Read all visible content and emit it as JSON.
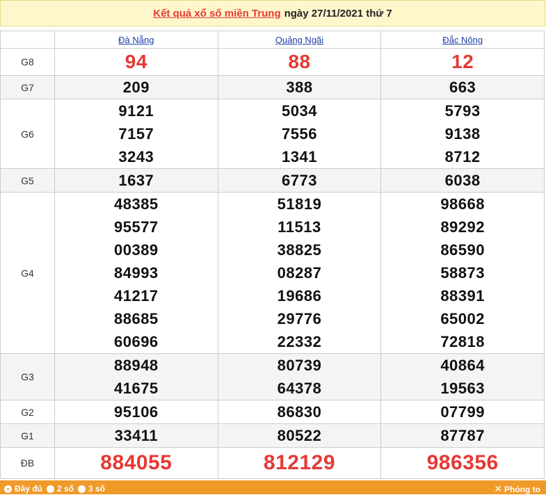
{
  "header": {
    "title_link": "Kết quả xổ số miền Trung",
    "date_text": "ngày 27/11/2021 thứ 7"
  },
  "provinces": [
    "Đà Nẵng",
    "Quảng Ngãi",
    "Đắc Nông"
  ],
  "prizes": [
    {
      "label": "G8",
      "style": "red",
      "values": [
        [
          "94"
        ],
        [
          "88"
        ],
        [
          "12"
        ]
      ]
    },
    {
      "label": "G7",
      "style": "normal",
      "values": [
        [
          "209"
        ],
        [
          "388"
        ],
        [
          "663"
        ]
      ]
    },
    {
      "label": "G6",
      "style": "normal",
      "values": [
        [
          "9121",
          "7157",
          "3243"
        ],
        [
          "5034",
          "7556",
          "1341"
        ],
        [
          "5793",
          "9138",
          "8712"
        ]
      ]
    },
    {
      "label": "G5",
      "style": "normal",
      "values": [
        [
          "1637"
        ],
        [
          "6773"
        ],
        [
          "6038"
        ]
      ]
    },
    {
      "label": "G4",
      "style": "normal",
      "values": [
        [
          "48385",
          "95577",
          "00389",
          "84993",
          "41217",
          "88685",
          "60696"
        ],
        [
          "51819",
          "11513",
          "38825",
          "08287",
          "19686",
          "29776",
          "22332"
        ],
        [
          "98668",
          "89292",
          "86590",
          "58873",
          "88391",
          "65002",
          "72818"
        ]
      ]
    },
    {
      "label": "G3",
      "style": "normal",
      "values": [
        [
          "88948",
          "41675"
        ],
        [
          "80739",
          "64378"
        ],
        [
          "40864",
          "19563"
        ]
      ]
    },
    {
      "label": "G2",
      "style": "normal",
      "values": [
        [
          "95106"
        ],
        [
          "86830"
        ],
        [
          "07799"
        ]
      ]
    },
    {
      "label": "G1",
      "style": "normal",
      "values": [
        [
          "33411"
        ],
        [
          "80522"
        ],
        [
          "87787"
        ]
      ]
    },
    {
      "label": "ĐB",
      "style": "special",
      "values": [
        [
          "884055"
        ],
        [
          "812129"
        ],
        [
          "986356"
        ]
      ]
    }
  ],
  "footer": {
    "options": [
      "Đầy đủ",
      "2 số",
      "3 số"
    ],
    "zoom_label": "Phóng to"
  },
  "colors": {
    "accent_red": "#e53935",
    "header_bg": "#fff7cc",
    "footer_bg": "#f09a2a",
    "link_blue": "#1a3da6"
  }
}
